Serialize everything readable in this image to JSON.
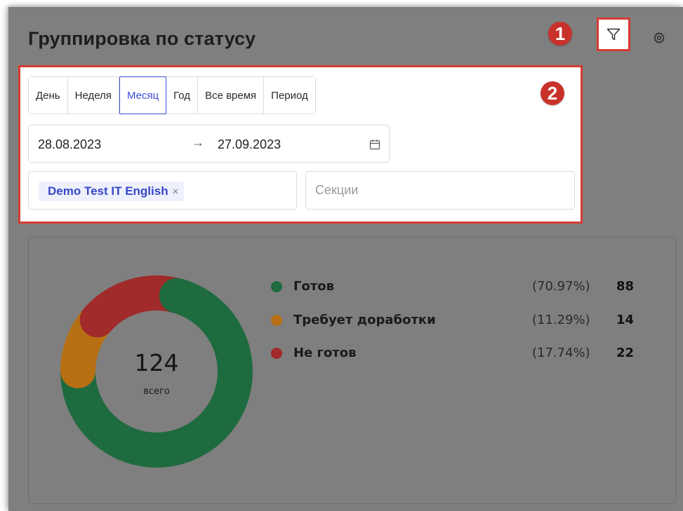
{
  "header": {
    "title": "Группировка по статусу",
    "filter_icon": "filter-funnel-icon",
    "settings_icon": "gear-icon"
  },
  "markers": [
    "1",
    "2"
  ],
  "filters": {
    "period_tabs": [
      {
        "label": "День",
        "active": false
      },
      {
        "label": "Неделя",
        "active": false
      },
      {
        "label": "Месяц",
        "active": true
      },
      {
        "label": "Год",
        "active": false
      },
      {
        "label": "Все время",
        "active": false
      },
      {
        "label": "Период",
        "active": false
      }
    ],
    "date_start": "28.08.2023",
    "date_arrow": "→",
    "date_end": "27.09.2023",
    "calendar_icon": "calendar-icon",
    "project_tag": "Demo Test IT English",
    "project_tag_remove": "×",
    "sections_placeholder": "Секции"
  },
  "chart_data": {
    "type": "pie",
    "variant": "donut",
    "total": {
      "value": "124",
      "label": "всего"
    },
    "series": [
      {
        "name": "Готов",
        "percent": "(70.97%)",
        "value": 88,
        "color": "#1e6b3f"
      },
      {
        "name": "Требует доработки",
        "percent": "(11.29%)",
        "value": 14,
        "color": "#b66f12"
      },
      {
        "name": "Не готов",
        "percent": "(17.74%)",
        "value": 22,
        "color": "#a12a2a"
      }
    ]
  },
  "colors": {
    "dim_background": "#7f7f7f",
    "highlight": "#d63a33",
    "accent": "#3b4fd8",
    "ready": "#1e6b3f",
    "needs_work": "#b66f12",
    "not_ready": "#a12a2a"
  }
}
